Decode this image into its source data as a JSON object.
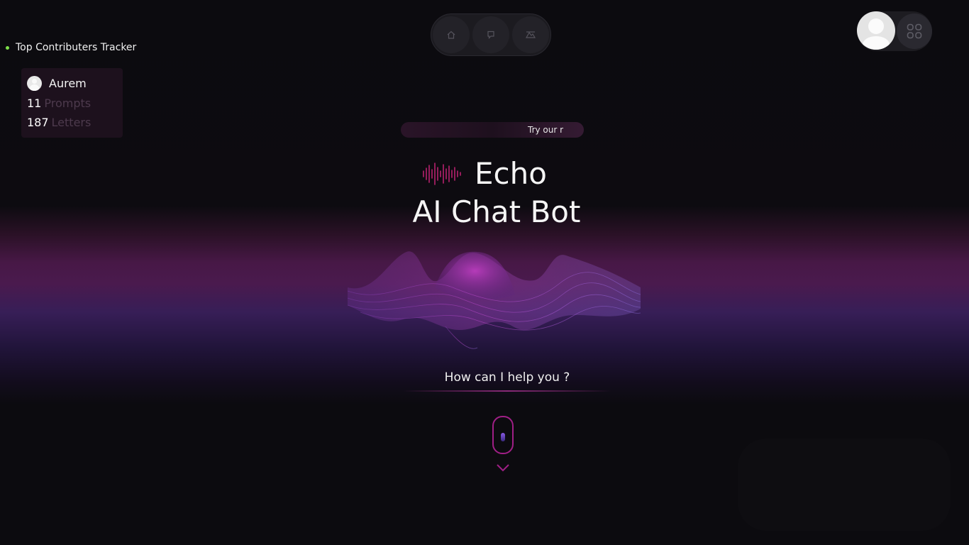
{
  "tracker": {
    "heading": "Top Contributers Tracker",
    "contributor": {
      "name": "Aurem",
      "prompts_count": "11",
      "prompts_label": "Prompts",
      "letters_count": "187",
      "letters_label": "Letters"
    }
  },
  "nav": {
    "items": [
      {
        "icon": "home-icon"
      },
      {
        "icon": "chat-icon"
      },
      {
        "icon": "image-icon"
      }
    ]
  },
  "profile": {
    "avatar_icon": "user-avatar-icon",
    "apps_icon": "grid-icon"
  },
  "banner": {
    "text": "Try our r"
  },
  "hero": {
    "title_line1": "Echo",
    "title_line2": "AI Chat Bot",
    "logo_icon": "soundwave-icon",
    "prompt": "How can I help you ?",
    "scroll_icon": "scroll-mouse-icon"
  },
  "colors": {
    "background": "#0c0b0f",
    "accent_magenta": "#a01f86",
    "accent_purple": "#8a5ae6",
    "status_dot": "#7ee04a",
    "text": "#f5f5f5"
  }
}
